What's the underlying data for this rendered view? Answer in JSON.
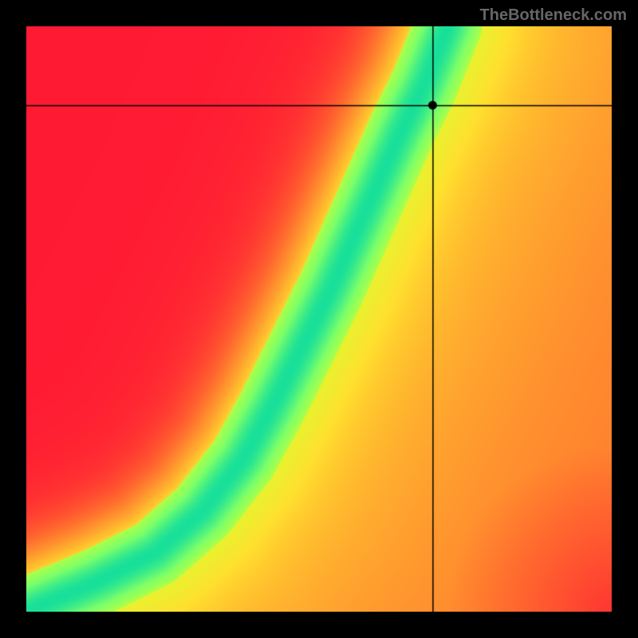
{
  "watermark": "TheBottleneck.com",
  "chart_data": {
    "type": "heatmap",
    "title": "",
    "xlabel": "",
    "ylabel": "",
    "xlim": [
      0,
      1
    ],
    "ylim": [
      0,
      1
    ],
    "crosshair": {
      "x": 0.695,
      "y": 0.865
    },
    "marker": {
      "x": 0.695,
      "y": 0.865
    },
    "ridge_path": [
      {
        "x": 0.0,
        "y": 0.0
      },
      {
        "x": 0.12,
        "y": 0.05
      },
      {
        "x": 0.22,
        "y": 0.1
      },
      {
        "x": 0.3,
        "y": 0.17
      },
      {
        "x": 0.37,
        "y": 0.26
      },
      {
        "x": 0.42,
        "y": 0.35
      },
      {
        "x": 0.47,
        "y": 0.45
      },
      {
        "x": 0.52,
        "y": 0.55
      },
      {
        "x": 0.56,
        "y": 0.64
      },
      {
        "x": 0.6,
        "y": 0.73
      },
      {
        "x": 0.64,
        "y": 0.82
      },
      {
        "x": 0.68,
        "y": 0.9
      },
      {
        "x": 0.72,
        "y": 1.0
      }
    ],
    "colormap": [
      {
        "t": 0.0,
        "color": "#ff1a33"
      },
      {
        "t": 0.3,
        "color": "#ff6a2e"
      },
      {
        "t": 0.55,
        "color": "#ffb02e"
      },
      {
        "t": 0.7,
        "color": "#ffe02e"
      },
      {
        "t": 0.85,
        "color": "#d8ff2e"
      },
      {
        "t": 0.93,
        "color": "#7aff6a"
      },
      {
        "t": 1.0,
        "color": "#18e09a"
      }
    ],
    "ridge_sigma_core": 0.035,
    "corner_falloff": 0.55
  }
}
